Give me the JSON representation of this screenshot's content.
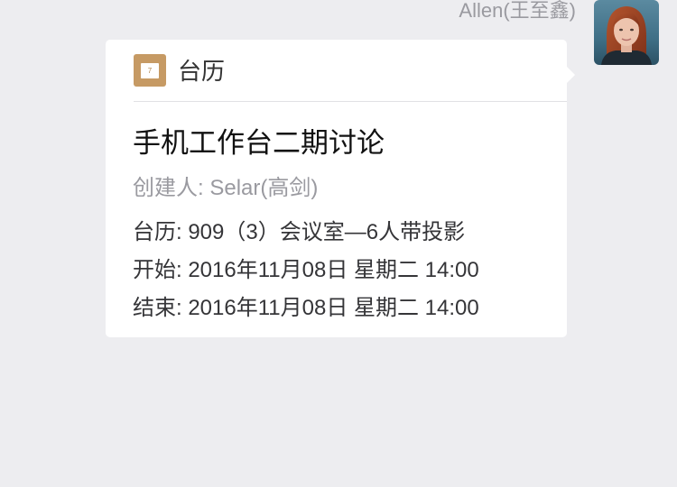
{
  "message": {
    "sender_name": "Allen(王至鑫)",
    "avatar": "avatar-photo"
  },
  "card": {
    "app_icon": "calendar-icon",
    "app_icon_day": "7",
    "app_name": "台历",
    "event_title": "手机工作台二期讨论",
    "creator": "创建人: Selar(高剑)",
    "calendar_line": "台历: 909（3）会议室—6人带投影",
    "start_line": "开始: 2016年11月08日 星期二 14:00",
    "end_line": "结束: 2016年11月08日 星期二 14:00"
  },
  "colors": {
    "background": "#ededf0",
    "card": "#ffffff",
    "icon_accent": "#c69a64",
    "muted_text": "#9a9aa0"
  }
}
